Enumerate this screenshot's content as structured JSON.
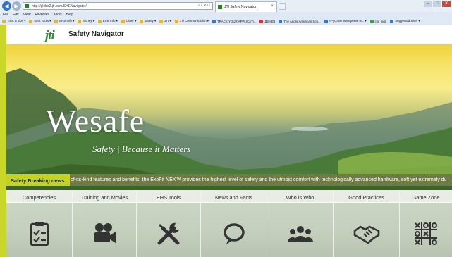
{
  "browser": {
    "url": "http://globe2.jti.com/SHENavigator/",
    "tab_title": "JTI Safety Navigator",
    "tab_close": "×",
    "menu": [
      "File",
      "Edit",
      "View",
      "Favorites",
      "Tools",
      "Help"
    ],
    "favorites": [
      {
        "label": "Trips & Tips ▾",
        "icon": "folder-icon"
      },
      {
        "label": "EHS Tools ▾",
        "icon": "folder-icon"
      },
      {
        "label": "EHS Info ▾",
        "icon": "folder-icon"
      },
      {
        "label": "Money ▾",
        "icon": "folder-icon"
      },
      {
        "label": "Emir Info ▾",
        "icon": "folder-icon"
      },
      {
        "label": "Other ▾",
        "icon": "folder-icon"
      },
      {
        "label": "Safety ▾",
        "icon": "folder-icon"
      },
      {
        "label": "JTI ▾",
        "icon": "folder-icon"
      },
      {
        "label": "JTI Communication ▾",
        "icon": "folder-icon"
      },
      {
        "label": "TRACK YOUR APPLICATI...",
        "icon": "page-icon"
      },
      {
        "label": "ДЕНЕВ",
        "icon": "page-icon"
      },
      {
        "label": "The Anglo-American Sch...",
        "icon": "page-icon"
      },
      {
        "label": "«Русские имперские м... ▾",
        "icon": "page-icon"
      },
      {
        "label": "chr_sign",
        "icon": "page-icon"
      },
      {
        "label": "Suggested Sites ▾",
        "icon": "page-icon"
      }
    ]
  },
  "header": {
    "logo_text": "jti",
    "site_title": "Safety Navigator"
  },
  "hero": {
    "title": "Wesafe",
    "subtitle": "Safety | Because it Matters"
  },
  "ticker": {
    "label": "Safety Breaking news",
    "text": "of-its-kind features and benefits, the ExoFit NEX™ provides the highest level of safety and the utmost comfort with technologically advanced hardware, soft yet extremely du"
  },
  "nav": [
    {
      "label": "Competencies",
      "icon": "checklist-icon"
    },
    {
      "label": "Training and Movies",
      "icon": "movie-camera-icon"
    },
    {
      "label": "EHS Tools",
      "icon": "tools-icon"
    },
    {
      "label": "News and Facts",
      "icon": "speech-bubble-icon"
    },
    {
      "label": "Who is Who",
      "icon": "people-icon"
    },
    {
      "label": "Good Practices",
      "icon": "handshake-icon"
    },
    {
      "label": "Game Zone",
      "icon": "tic-tac-toe-icon"
    }
  ],
  "colors": {
    "accent": "#c3d31f",
    "brand_green": "#2f8f33",
    "ticker_bg": "#6f7a45"
  }
}
